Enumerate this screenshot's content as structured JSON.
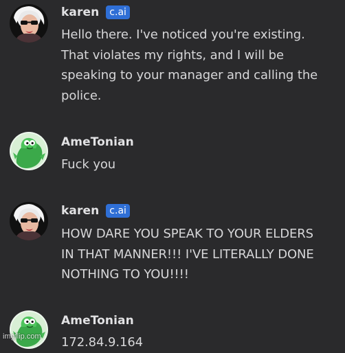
{
  "messages": [
    {
      "author": "karen",
      "badge": "c.ai",
      "text": "Hello there. I've noticed you're existing.\nThat violates my rights, and I will be\nspeaking to your manager and calling the\npolice.",
      "avatar": "woman-avatar-icon"
    },
    {
      "author": "AmeTonian",
      "text": "Fuck you",
      "avatar": "green-creature-avatar-icon"
    },
    {
      "author": "karen",
      "badge": "c.ai",
      "text": "HOW DARE YOU SPEAK TO YOUR ELDERS\nIN THAT MANNER!!! I'VE LITERALLY DONE\nNOTHING TO YOU!!!!",
      "avatar": "woman-avatar-icon"
    },
    {
      "author": "AmeTonian",
      "text": "172.84.9.164",
      "avatar": "green-creature-avatar-icon"
    }
  ],
  "watermark": "imgflip.com",
  "colors": {
    "background": "#2a2a2c",
    "badge": "#2f6fd6",
    "name": "#e2e2e4",
    "text": "#d7d7d9"
  }
}
